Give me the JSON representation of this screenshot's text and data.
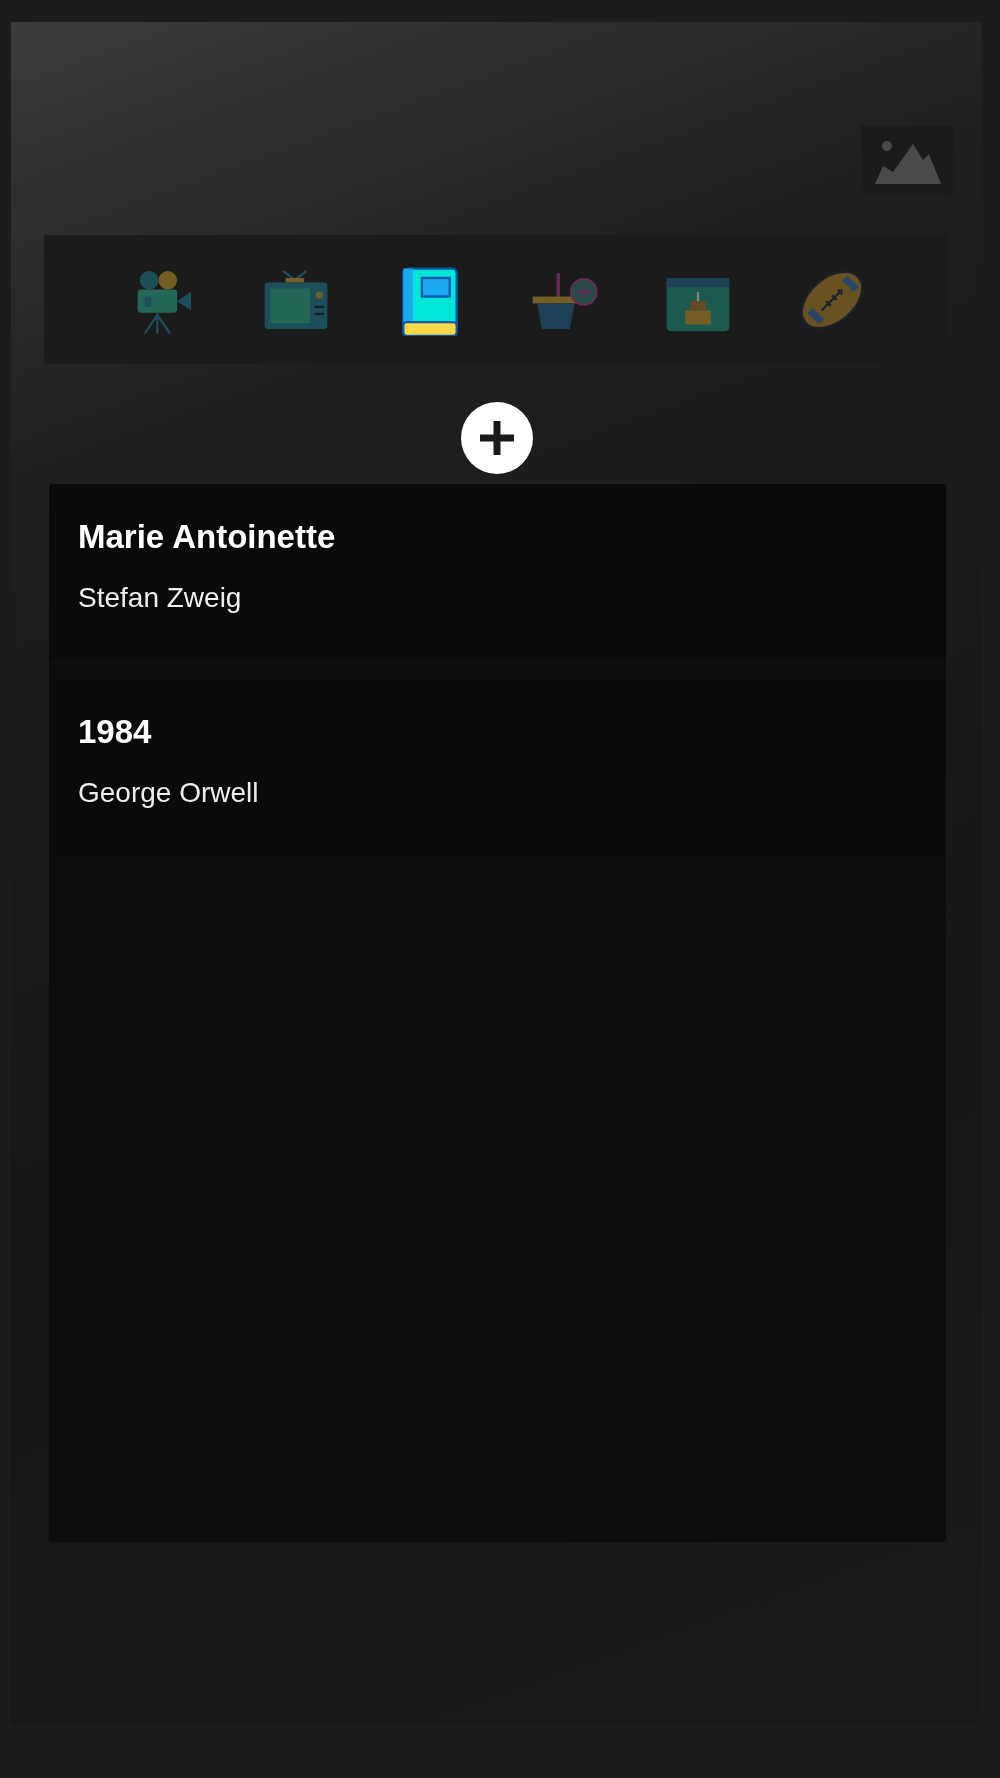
{
  "categories": [
    {
      "kind": "movies",
      "selected": false
    },
    {
      "kind": "tv",
      "selected": false
    },
    {
      "kind": "books",
      "selected": true
    },
    {
      "kind": "shopping",
      "selected": false
    },
    {
      "kind": "birthdays",
      "selected": false
    },
    {
      "kind": "sports",
      "selected": false
    }
  ],
  "items": [
    {
      "title": "Marie Antoinette",
      "author": "Stefan Zweig"
    },
    {
      "title": "1984",
      "author": "George Orwell"
    }
  ]
}
